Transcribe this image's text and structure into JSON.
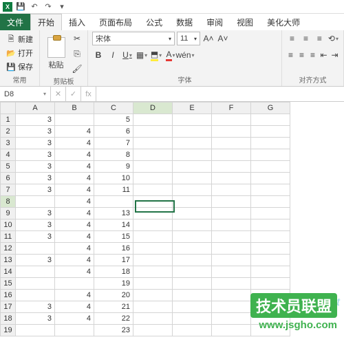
{
  "qat": {
    "excel": "X",
    "save": "💾",
    "undo": "↶",
    "redo": "↷",
    "more": "▾"
  },
  "tabs": {
    "file": "文件",
    "home": "开始",
    "insert": "插入",
    "layout": "页面布局",
    "formula": "公式",
    "data": "数据",
    "review": "审阅",
    "view": "视图",
    "beautify": "美化大师"
  },
  "groups": {
    "common": "常用",
    "clipboard": "剪贴板",
    "font": "字体",
    "align": "对齐方式"
  },
  "common": {
    "new": "新建",
    "open": "打开",
    "save": "保存"
  },
  "clipboard": {
    "paste": "粘贴"
  },
  "font": {
    "name": "宋体",
    "size": "11",
    "bold": "B",
    "italic": "I",
    "underline": "U"
  },
  "namebox": "D8",
  "fx": "fx",
  "cols": [
    "A",
    "B",
    "C",
    "D",
    "E",
    "F",
    "G"
  ],
  "rows": [
    {
      "n": "1",
      "c": [
        "3",
        "",
        "5",
        "",
        "",
        "",
        ""
      ]
    },
    {
      "n": "2",
      "c": [
        "3",
        "4",
        "6",
        "",
        "",
        "",
        ""
      ]
    },
    {
      "n": "3",
      "c": [
        "3",
        "4",
        "7",
        "",
        "",
        "",
        ""
      ]
    },
    {
      "n": "4",
      "c": [
        "3",
        "4",
        "8",
        "",
        "",
        "",
        ""
      ]
    },
    {
      "n": "5",
      "c": [
        "3",
        "4",
        "9",
        "",
        "",
        "",
        ""
      ]
    },
    {
      "n": "6",
      "c": [
        "3",
        "4",
        "10",
        "",
        "",
        "",
        ""
      ]
    },
    {
      "n": "7",
      "c": [
        "3",
        "4",
        "11",
        "",
        "",
        "",
        ""
      ]
    },
    {
      "n": "8",
      "c": [
        "",
        "4",
        "",
        "",
        "",
        "",
        ""
      ]
    },
    {
      "n": "9",
      "c": [
        "3",
        "4",
        "13",
        "",
        "",
        "",
        ""
      ]
    },
    {
      "n": "10",
      "c": [
        "3",
        "4",
        "14",
        "",
        "",
        "",
        ""
      ]
    },
    {
      "n": "11",
      "c": [
        "3",
        "4",
        "15",
        "",
        "",
        "",
        ""
      ]
    },
    {
      "n": "12",
      "c": [
        "",
        "4",
        "16",
        "",
        "",
        "",
        ""
      ]
    },
    {
      "n": "13",
      "c": [
        "3",
        "4",
        "17",
        "",
        "",
        "",
        ""
      ]
    },
    {
      "n": "14",
      "c": [
        "",
        "4",
        "18",
        "",
        "",
        "",
        ""
      ]
    },
    {
      "n": "15",
      "c": [
        "",
        "",
        "19",
        "",
        "",
        "",
        ""
      ]
    },
    {
      "n": "16",
      "c": [
        "",
        "4",
        "20",
        "",
        "",
        "",
        ""
      ]
    },
    {
      "n": "17",
      "c": [
        "3",
        "4",
        "21",
        "",
        "",
        "",
        ""
      ]
    },
    {
      "n": "18",
      "c": [
        "3",
        "4",
        "22",
        "",
        "",
        "",
        ""
      ]
    },
    {
      "n": "19",
      "c": [
        "",
        "",
        "23",
        "",
        "",
        "",
        ""
      ]
    }
  ],
  "active": {
    "row": 8,
    "col": 4
  },
  "wm": {
    "line1": "技术员联盟",
    "line2": "www.jsgho.com",
    "line3": "脚本之家 Net"
  }
}
